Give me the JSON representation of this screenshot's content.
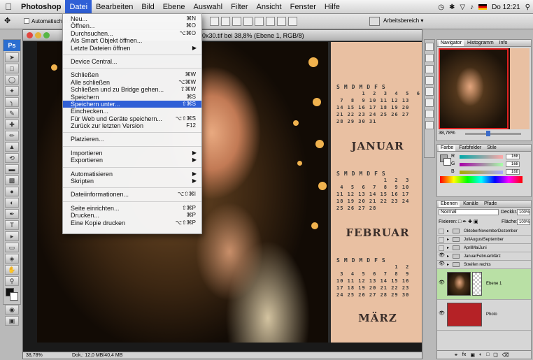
{
  "menubar": {
    "apple": "",
    "items": [
      "Photoshop",
      "Datei",
      "Bearbeiten",
      "Bild",
      "Ebene",
      "Auswahl",
      "Filter",
      "Ansicht",
      "Fenster",
      "Hilfe"
    ],
    "active": "Datei",
    "clock": "Do 12:21"
  },
  "options": {
    "auto_select": "Automatisch ausw.",
    "workspace": "Arbeitsbereich ▾"
  },
  "document": {
    "title": "0x30.tif bei 38,8% (Ebene 1, RGB/8)",
    "zoom": "38,78%",
    "doc_size": "Dok.: 12,0 MB/40,4 MB"
  },
  "file_menu": [
    {
      "label": "Neu...",
      "shortcut": "⌘N"
    },
    {
      "label": "Öffnen...",
      "shortcut": "⌘O"
    },
    {
      "label": "Durchsuchen...",
      "shortcut": "⌥⌘O"
    },
    {
      "label": "Als Smart Objekt öffnen...",
      "shortcut": ""
    },
    {
      "label": "Letzte Dateien öffnen",
      "shortcut": "▶"
    },
    {
      "sep": true
    },
    {
      "label": "Device Central...",
      "shortcut": ""
    },
    {
      "sep": true
    },
    {
      "label": "Schließen",
      "shortcut": "⌘W"
    },
    {
      "label": "Alle schließen",
      "shortcut": "⌥⌘W"
    },
    {
      "label": "Schließen und zu Bridge gehen...",
      "shortcut": "⇧⌘W"
    },
    {
      "label": "Speichern",
      "shortcut": "⌘S"
    },
    {
      "label": "Speichern unter...",
      "shortcut": "⇧⌘S",
      "highlight": true
    },
    {
      "label": "Einchecken...",
      "shortcut": ""
    },
    {
      "label": "Für Web und Geräte speichern...",
      "shortcut": "⌥⇧⌘S"
    },
    {
      "label": "Zurück zur letzten Version",
      "shortcut": "F12"
    },
    {
      "sep": true
    },
    {
      "label": "Platzieren...",
      "shortcut": ""
    },
    {
      "sep": true
    },
    {
      "label": "Importieren",
      "shortcut": "▶"
    },
    {
      "label": "Exportieren",
      "shortcut": "▶"
    },
    {
      "sep": true
    },
    {
      "label": "Automatisieren",
      "shortcut": "▶"
    },
    {
      "label": "Skripten",
      "shortcut": "▶"
    },
    {
      "sep": true
    },
    {
      "label": "Dateiinformationen...",
      "shortcut": "⌥⇧⌘I"
    },
    {
      "sep": true
    },
    {
      "label": "Seite einrichten...",
      "shortcut": "⇧⌘P"
    },
    {
      "label": "Drucken...",
      "shortcut": "⌘P"
    },
    {
      "label": "Eine Kopie drucken",
      "shortcut": "⌥⇧⌘P"
    }
  ],
  "calendar": {
    "weekdays": "SMDMDFS",
    "months": [
      {
        "name": "JANUAR",
        "days": "       1  2  3  4  5  6\n 7  8  9 10 11 12 13\n14 15 16 17 18 19 20\n21 22 23 24 25 26 27\n28 29 30 31"
      },
      {
        "name": "FEBRUAR",
        "days": "             1  2  3\n 4  5  6  7  8  9 10\n11 12 13 14 15 16 17\n18 19 20 21 22 23 24\n25 26 27 28"
      },
      {
        "name": "MÄRZ",
        "days": "                1  2\n 3  4  5  6  7  8  9\n10 11 12 13 14 15 16\n17 18 19 20 21 22 23\n24 25 26 27 28 29 30"
      }
    ]
  },
  "navigator": {
    "tabs": [
      "Navigator",
      "Histogramm",
      "Info"
    ],
    "zoom": "38,78%"
  },
  "color_panel": {
    "tabs": [
      "Farbe",
      "Farbfelder",
      "Stile"
    ],
    "rows": [
      {
        "label": "R",
        "value": "168"
      },
      {
        "label": "G",
        "value": "168"
      },
      {
        "label": "B",
        "value": "168"
      }
    ]
  },
  "layers_panel": {
    "tabs": [
      "Ebenen",
      "Kanäle",
      "Pfade"
    ],
    "blend_mode": "Normal",
    "opacity_label": "Deckkr.:",
    "opacity": "100%",
    "lock_label": "Fixieren:",
    "fill_label": "Fläche:",
    "fill": "100%",
    "layers": [
      {
        "name": "OktoberNovemberDezember",
        "type": "folder",
        "visible": false
      },
      {
        "name": "JuliAugustSeptember",
        "type": "folder",
        "visible": false
      },
      {
        "name": "AprilMaiJuni",
        "type": "folder",
        "visible": false
      },
      {
        "name": "JanuarFebruarMärz",
        "type": "folder",
        "visible": true
      },
      {
        "name": "Streifen rechts",
        "type": "folder",
        "visible": true
      },
      {
        "name": "Ebene 1",
        "type": "image",
        "visible": true,
        "selected": true
      },
      {
        "name": "Photo",
        "type": "red",
        "visible": true
      }
    ]
  },
  "colors": {
    "accent": "#2f5fd6",
    "dots": "#f0b24e",
    "calendar_bg": "#e9c0a2",
    "layer_selected": "#b9e0a5",
    "photo_layer": "#b52226"
  }
}
